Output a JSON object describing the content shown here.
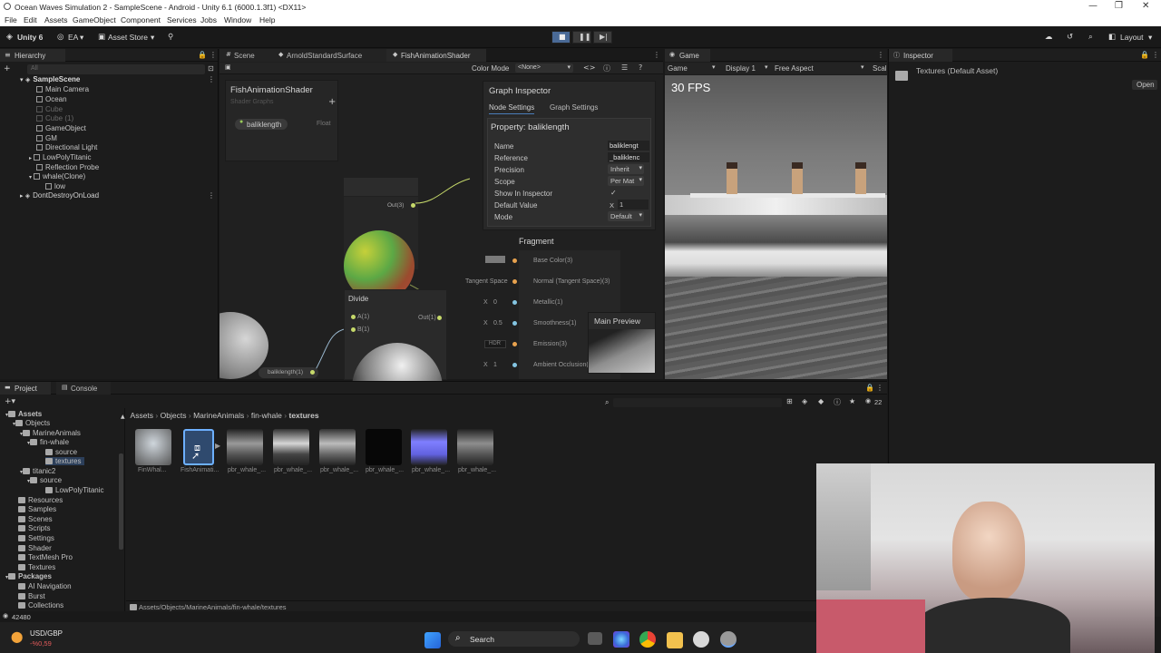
{
  "window": {
    "title": "Ocean Waves Simulation 2 - SampleScene - Android - Unity 6.1 (6000.1.3f1) <DX11>"
  },
  "menu": [
    "File",
    "Edit",
    "Assets",
    "GameObject",
    "Component",
    "Services",
    "Jobs",
    "Window",
    "Help"
  ],
  "toolbar": {
    "account": "Unity 6",
    "ea": "EA",
    "asset_store": "Asset Store",
    "layout": "Layout"
  },
  "hierarchy": {
    "title": "Hierarchy",
    "search_placeholder": "All",
    "scene": "SampleScene",
    "items": [
      "Main Camera",
      "Ocean",
      "Cube",
      "Cube (1)",
      "GameObject",
      "GM",
      "Directional Light",
      "LowPolyTitanic",
      "Reflection Probe",
      "whale(Clone)",
      "low"
    ],
    "ddol": "DontDestroyOnLoad"
  },
  "center_tabs": [
    "Scene",
    "ArnoldStandardSurface",
    "FishAnimationShader"
  ],
  "shader": {
    "color_mode_label": "Color Mode",
    "color_mode_value": "<None>",
    "blackboard_title": "FishAnimationShader",
    "blackboard_sub": "Shader Graphs",
    "prop_name": "baliklength",
    "prop_type": "Float",
    "out_label": "Out(3)",
    "divide_title": "Divide",
    "divide_a": "A(1)",
    "divide_b": "B(1)",
    "divide_out": "Out(1)",
    "baliklength_node": "baliklength(1)",
    "fragment_title": "Fragment",
    "fragment_rows": [
      "Base Color(3)",
      "Normal (Tangent Space)(3)",
      "Metallic(1)",
      "Smoothness(1)",
      "Emission(3)",
      "Ambient Occlusion(1)"
    ],
    "tangent_space": "Tangent Space",
    "metallic_x": "X",
    "metallic_val": "0",
    "smooth_x": "X",
    "smooth_val": "0.5",
    "hdr": "HDR",
    "ao_x": "X",
    "ao_val": "1",
    "main_preview": "Main Preview"
  },
  "graph_inspector": {
    "title": "Graph Inspector",
    "tabs": [
      "Node Settings",
      "Graph Settings"
    ],
    "property_header": "Property: baliklength",
    "rows": [
      {
        "label": "Name",
        "value": "baliklengt"
      },
      {
        "label": "Reference",
        "value": "_baliklenc"
      },
      {
        "label": "Precision",
        "value": "Inherit"
      },
      {
        "label": "Scope",
        "value": "Per Mat"
      },
      {
        "label": "Show In Inspector",
        "value": "✓"
      },
      {
        "label": "Default Value",
        "value": "1"
      },
      {
        "label": "Mode",
        "value": "Default"
      }
    ],
    "default_x": "X"
  },
  "game": {
    "tab": "Game",
    "mode": "Game",
    "display": "Display 1",
    "aspect": "Free Aspect",
    "scale": "Scal",
    "fps": "30 FPS"
  },
  "inspector": {
    "title": "Inspector",
    "asset": "Textures (Default Asset)",
    "open": "Open"
  },
  "project": {
    "tabs": [
      "Project",
      "Console"
    ],
    "breadcrumb": [
      "Assets",
      "Objects",
      "MarineAnimals",
      "fin-whale",
      "textures"
    ],
    "count": "22",
    "tree": [
      {
        "label": "Assets",
        "level": 0,
        "bold": true
      },
      {
        "label": "Objects",
        "level": 1
      },
      {
        "label": "MarineAnimals",
        "level": 2
      },
      {
        "label": "fin-whale",
        "level": 3
      },
      {
        "label": "source",
        "level": 4
      },
      {
        "label": "textures",
        "level": 4
      },
      {
        "label": "titanic2",
        "level": 2
      },
      {
        "label": "source",
        "level": 3
      },
      {
        "label": "LowPolyTitanic",
        "level": 4
      },
      {
        "label": "Resources",
        "level": 1
      },
      {
        "label": "Samples",
        "level": 1
      },
      {
        "label": "Scenes",
        "level": 1
      },
      {
        "label": "Scripts",
        "level": 1
      },
      {
        "label": "Settings",
        "level": 1
      },
      {
        "label": "Shader",
        "level": 1
      },
      {
        "label": "TextMesh Pro",
        "level": 1
      },
      {
        "label": "Textures",
        "level": 1
      },
      {
        "label": "Packages",
        "level": 0,
        "bold": true
      },
      {
        "label": "AI Navigation",
        "level": 1
      },
      {
        "label": "Burst",
        "level": 1
      },
      {
        "label": "Collections",
        "level": 1
      }
    ],
    "files": [
      "FinWhal...",
      "FishAnimati...",
      "pbr_whale_...",
      "pbr_whale_...",
      "pbr_whale_...",
      "pbr_whale_...",
      "pbr_whale_...",
      "pbr_whale_..."
    ],
    "path": "Assets/Objects/MarineAnimals/fin-whale/textures"
  },
  "status": {
    "count": "42480"
  },
  "taskbar": {
    "ticker": "USD/GBP",
    "change": "-%0,59",
    "search": "Search"
  }
}
